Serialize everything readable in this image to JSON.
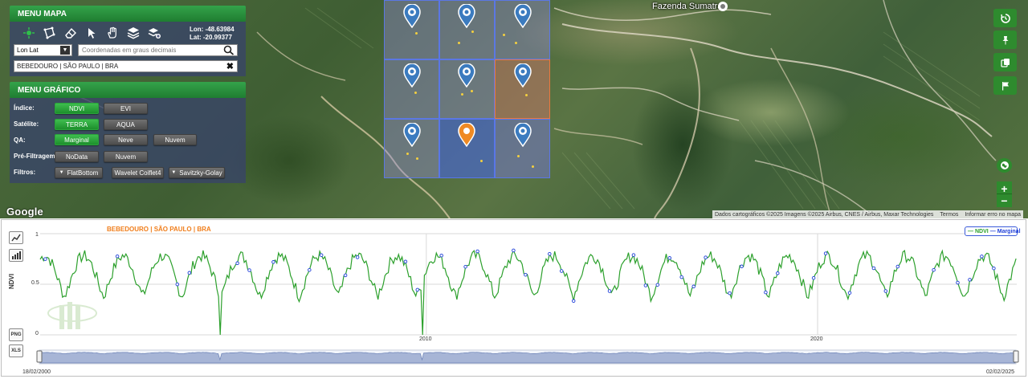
{
  "map": {
    "place_label": "Fazenda Sumatra",
    "google_logo": "Google",
    "attribution": "Dados cartográficos ©2025 Imagens ©2025 Airbus, CNES / Airbus, Maxar Technologies",
    "terms": "Termos",
    "report_error": "Informar erro no mapa",
    "controls": [
      "history-icon",
      "pin-icon",
      "layers-copy-icon",
      "flag-icon",
      "globe-icon"
    ],
    "zoom_in": "+",
    "zoom_out": "−",
    "grid_cells": [
      {
        "row": 0,
        "col": 0,
        "style": "lightblue"
      },
      {
        "row": 0,
        "col": 1,
        "style": "lightblue"
      },
      {
        "row": 0,
        "col": 2,
        "style": "lightblue"
      },
      {
        "row": 1,
        "col": 0,
        "style": "lightblue"
      },
      {
        "row": 1,
        "col": 1,
        "style": "lightblue"
      },
      {
        "row": 1,
        "col": 2,
        "style": "orange"
      },
      {
        "row": 2,
        "col": 0,
        "style": "lightblue"
      },
      {
        "row": 2,
        "col": 1,
        "style": "strong"
      },
      {
        "row": 2,
        "col": 2,
        "style": "blue"
      }
    ],
    "selected_cell": {
      "row": 2,
      "col": 1
    }
  },
  "menu_mapa": {
    "title": "MENU MAPA",
    "tools": [
      "point-icon",
      "polygon-icon",
      "eraser-icon",
      "cursor-icon",
      "hand-icon",
      "layers-icon",
      "layers-plus-icon"
    ],
    "lon_text": "Lon: -48.63984",
    "lat_text": "Lat: -20.99377",
    "coord_system": "Lon Lat",
    "coord_placeholder": "Coordenadas em graus decimais",
    "location": "BEBEDOURO | SÃO PAULO | BRA"
  },
  "menu_grafico": {
    "title": "MENU GRÁFICO",
    "indice_label": "Índice:",
    "indice_options": [
      {
        "label": "NDVI",
        "active": true
      },
      {
        "label": "EVI",
        "active": false
      }
    ],
    "satelite_label": "Satélite:",
    "satelite_options": [
      {
        "label": "TERRA",
        "active": true
      },
      {
        "label": "AQUA",
        "active": false
      }
    ],
    "qa_label": "QA:",
    "qa_options": [
      {
        "label": "Marginal",
        "active": true
      },
      {
        "label": "Neve",
        "active": false
      },
      {
        "label": "Nuvem",
        "active": false
      }
    ],
    "prefiltragem_label": "Pré-Filtragem:",
    "prefiltragem_options": [
      {
        "label": "NoData",
        "active": false
      },
      {
        "label": "Nuvem",
        "active": false
      }
    ],
    "filtros_label": "Filtros:",
    "filtros_options": [
      {
        "label": "FlatBottom",
        "dropdown": true
      },
      {
        "label": "Wavelet Coiflet4",
        "dropdown": false
      },
      {
        "label": "Savitzky-Golay",
        "dropdown": true
      }
    ]
  },
  "chart_side_buttons": {
    "png": "PNG",
    "xls": "XLS"
  },
  "chart_data": {
    "type": "line",
    "title": "BEBEDOURO | SÃO PAULO | BRA",
    "ylabel": "NDVI",
    "xlabel": "",
    "ylim": [
      0,
      1
    ],
    "yticks": [
      "0",
      "0.5",
      "1"
    ],
    "xticks": [
      "2010",
      "2020"
    ],
    "x_range": [
      "18/02/2000",
      "02/02/2025"
    ],
    "legend": [
      {
        "name": "NDVI",
        "color": "#2ca02c"
      },
      {
        "name": "Marginal",
        "color": "#1f3fd9"
      }
    ],
    "legend_position": "top-right",
    "grid": true,
    "series": [
      {
        "name": "NDVI",
        "color": "#2ca02c",
        "x_start_year": 2000.13,
        "x_end_year": 2025.09,
        "annual_pattern": {
          "peak": 0.78,
          "trough": 0.38
        },
        "dropouts": [
          {
            "year": 2004.75,
            "value": 0.0
          },
          {
            "year": 2009.9,
            "value": 0.0
          }
        ]
      },
      {
        "name": "Marginal",
        "color": "#1f3fd9",
        "marker": "circle"
      }
    ],
    "navigator_start": "18/02/2000",
    "navigator_end": "02/02/2025"
  }
}
